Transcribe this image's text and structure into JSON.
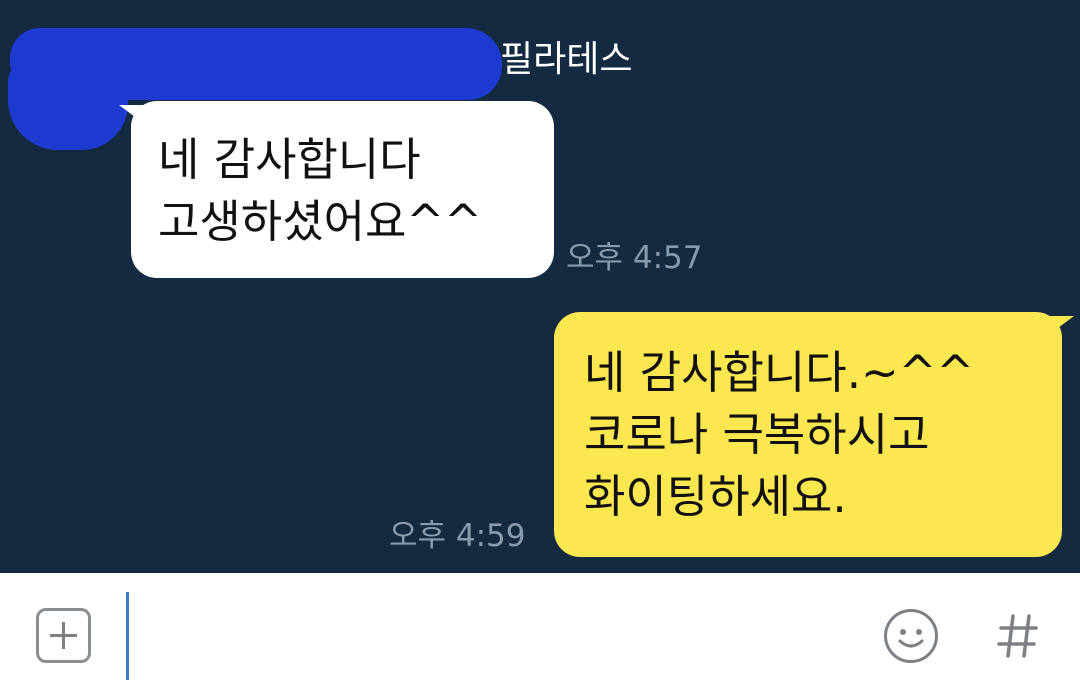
{
  "chat": {
    "sender_name": "필라테스",
    "incoming": {
      "lines": [
        "네 감사합니다",
        "고생하셨어요^^"
      ],
      "time": "오후 4:57"
    },
    "outgoing": {
      "lines": [
        "네 감사합니다.~^^",
        "코로나 극복하시고",
        "화이팅하세요."
      ],
      "time": "오후 4:59"
    }
  },
  "input_bar": {
    "message_value": "",
    "icons": {
      "attach": "plus-square-icon",
      "emoji": "smiley-icon",
      "hashtag": "hash-icon"
    }
  },
  "colors": {
    "chat_background": "#142a40",
    "incoming_bubble": "#ffffff",
    "outgoing_bubble": "#fbe74f",
    "timestamp": "#8a9aab",
    "redaction": "#1d3bd1",
    "cursor": "#3b7bc6"
  }
}
